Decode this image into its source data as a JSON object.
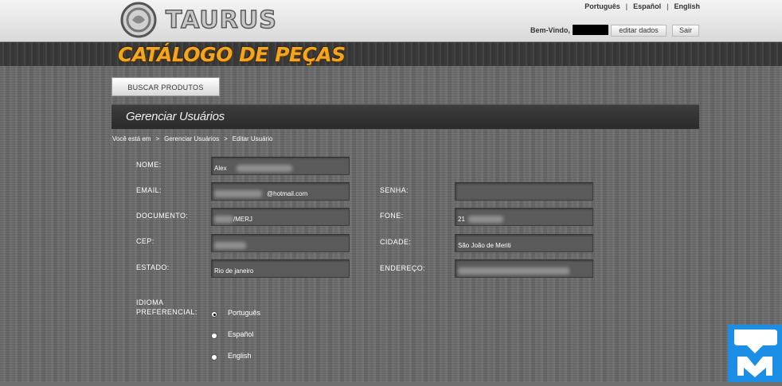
{
  "header": {
    "logo_text": "TAURUS",
    "languages": [
      "Português",
      "Español",
      "English"
    ],
    "welcome_label": "Bem-Vindo,",
    "edit_button": "editar dados",
    "exit_button": "Sair"
  },
  "catalog_title": "CATÁLOGO DE PEÇAS",
  "nav": {
    "search_button": "BUSCAR PRODUTOS"
  },
  "section_title": "Gerenciar Usuários",
  "breadcrumb": [
    "Você está em",
    "Gerenciar Usuários",
    "Editar Usuário"
  ],
  "breadcrumb_sep": ">",
  "form": {
    "nome_label": "NOME:",
    "nome_value": "Alex",
    "email_label": "EMAIL:",
    "email_value": "@hotmail.com",
    "senha_label": "SENHA:",
    "senha_value": "",
    "documento_label": "DOCUMENTO:",
    "documento_value": "/MERJ",
    "fone_label": "FONE:",
    "fone_value": "21",
    "cep_label": "CEP:",
    "cep_value": "",
    "cidade_label": "CIDADE:",
    "cidade_value": "São João de Meriti",
    "estado_label": "ESTADO:",
    "estado_value": "Rio de janeiro",
    "endereco_label": "ENDEREÇO:",
    "endereco_value": "",
    "idioma_label_1": "IDIOMA",
    "idioma_label_2": "PREFERENCIAL:",
    "idioma_options": [
      "Português",
      "Español",
      "English"
    ],
    "idioma_selected": "Português"
  }
}
